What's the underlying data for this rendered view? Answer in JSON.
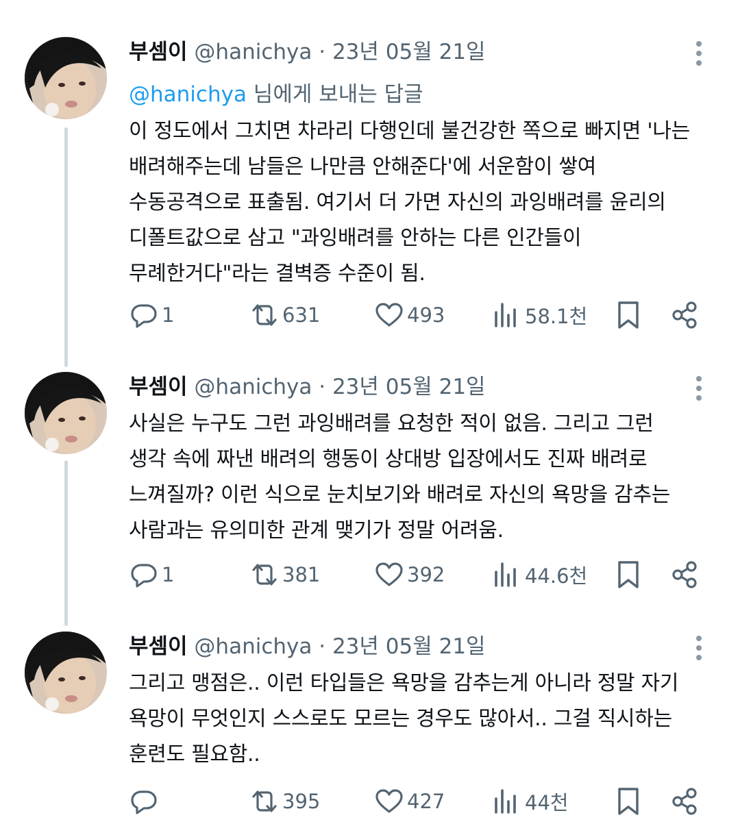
{
  "tweets": [
    {
      "name": "부셈이",
      "handle": "@hanichya",
      "dot": "·",
      "date": "23년 05월 21일",
      "replying_to": {
        "mention": "@hanichya",
        "suffix": " 님에게 보내는 답글"
      },
      "text": "이 정도에서 그치면 차라리 다행인데 불건강한 쪽으로 빠지면 '나는\n배려해주는데 남들은 나만큼 안해준다'에 서운함이 쌓여\n수동공격으로 표출됨. 여기서 더 가면 자신의 과잉배려를 윤리의\n디폴트값으로 삼고 \"과잉배려를 안하는 다른 인간들이\n무례한거다\"라는 결벽증 수준이 됨.",
      "replies": "1",
      "retweets": "631",
      "likes": "493",
      "views": "58.1천"
    },
    {
      "name": "부셈이",
      "handle": "@hanichya",
      "dot": "·",
      "date": "23년 05월 21일",
      "text": "사실은 누구도 그런 과잉배려를 요청한 적이 없음. 그리고 그런\n생각 속에 짜낸 배려의 행동이 상대방 입장에서도 진짜 배려로\n느껴질까? 이런 식으로 눈치보기와 배려로 자신의 욕망을 감추는\n사람과는 유의미한 관계 맺기가 정말 어려움.",
      "replies": "1",
      "retweets": "381",
      "likes": "392",
      "views": "44.6천"
    },
    {
      "name": "부셈이",
      "handle": "@hanichya",
      "dot": "·",
      "date": "23년 05월 21일",
      "text": "그리고 맹점은.. 이런 타입들은 욕망을 감추는게 아니라 정말 자기\n욕망이 무엇인지 스스로도 모르는 경우도 많아서.. 그걸 직시하는\n훈련도 필요함..",
      "replies": "",
      "retweets": "395",
      "likes": "427",
      "views": "44천"
    }
  ],
  "icons": {
    "reply": "reply-icon",
    "retweet": "retweet-icon",
    "like": "heart-icon",
    "views": "views-icon",
    "bookmark": "bookmark-icon",
    "share": "share-icon",
    "more": "more-icon"
  },
  "colors": {
    "text": "#0f1419",
    "secondary": "#536471",
    "mention": "#1d9bf0",
    "thread_line": "#cfd9de"
  }
}
